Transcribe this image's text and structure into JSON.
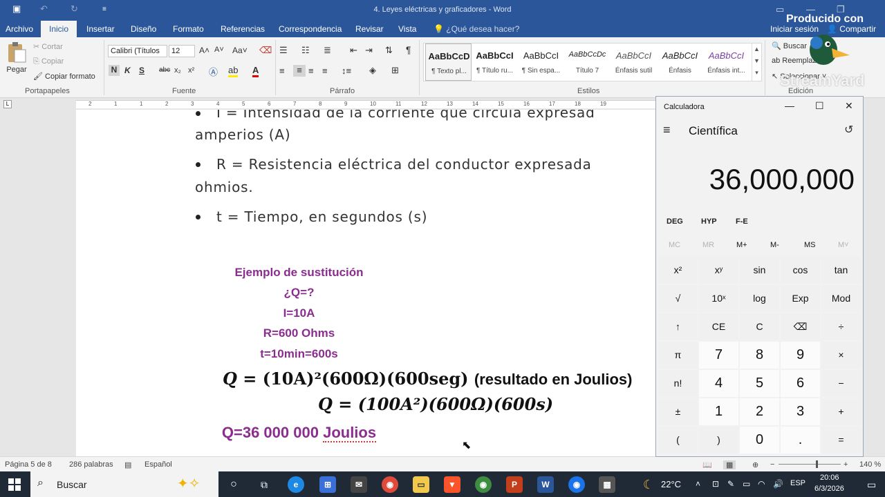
{
  "word": {
    "title": "4. Leyes eléctricas y graficadores - Word",
    "tabs": [
      "Archivo",
      "Inicio",
      "Insertar",
      "Diseño",
      "Formato",
      "Referencias",
      "Correspondencia",
      "Revisar",
      "Vista"
    ],
    "tell_me": "¿Qué desea hacer?",
    "signin": "Iniciar sesión",
    "share": "Compartir",
    "clipboard": {
      "paste": "Pegar",
      "cut": "Cortar",
      "copy": "Copiar",
      "format_painter": "Copiar formato",
      "label": "Portapapeles"
    },
    "font": {
      "name": "Calibri (Títulos",
      "size": "12",
      "label": "Fuente",
      "case": "Aa",
      "bold": "N",
      "italic": "K",
      "underline": "S",
      "strike": "abc",
      "sub": "x₂",
      "sup": "x²"
    },
    "paragraph": {
      "label": "Párrafo"
    },
    "styles": {
      "label": "Estilos",
      "items": [
        {
          "sample": "AaBbCcD",
          "name": "¶ Texto pl..."
        },
        {
          "sample": "AaBbCcI",
          "name": "¶ Título ru..."
        },
        {
          "sample": "AaBbCcI",
          "name": "¶ Sin espa..."
        },
        {
          "sample": "AaBbCcDc",
          "name": "Título 7"
        },
        {
          "sample": "AaBbCcI",
          "name": "Énfasis sutil"
        },
        {
          "sample": "AaBbCcI",
          "name": "Énfasis"
        },
        {
          "sample": "AaBbCcI",
          "name": "Énfasis int..."
        }
      ]
    },
    "editing": {
      "label": "Edición",
      "find": "Buscar",
      "replace": "Reemplazar",
      "select": "Seleccionar"
    },
    "watermark": {
      "produced_by": "Producido con",
      "brand": "StreamYard"
    },
    "ruler_numbers": [
      "2",
      "1",
      "1",
      "2",
      "3",
      "4",
      "5",
      "6",
      "7",
      "8",
      "9",
      "10",
      "11",
      "12",
      "13",
      "14",
      "15",
      "16",
      "17",
      "18",
      "19"
    ]
  },
  "document": {
    "bullet_partial": "I = Intensidad de la corriente que circula expresad",
    "bullet_i_cont": "amperios (A)",
    "bullet_r": "R = Resistencia eléctrica del conductor expresada",
    "bullet_r_cont": "ohmios.",
    "bullet_t": "t = Tiempo, en segundos (s)",
    "example_title": "Ejemplo de sustitución",
    "q": "¿Q=?",
    "i": "I=10A",
    "r": "R=600 Ohms",
    "t": "t=10min=600s",
    "eq1_lhs": "Q",
    "eq1_rhs": "=  (10A)²(600Ω)(600seg)",
    "eq1_note": "(resultado en Joulios)",
    "eq2": "Q = (100A²)(600Ω)(600s)",
    "result_main": "Q=36 000 000 ",
    "result_unit": "Joulios"
  },
  "status": {
    "page": "Página 5 de 8",
    "words": "286 palabras",
    "language": "Español",
    "zoom": "140 %",
    "zoom_fraction": 0.62
  },
  "taskbar": {
    "search": "Buscar",
    "weather": "22°C",
    "lang": "ESP",
    "time": "20:06",
    "date": "6/3/2026"
  },
  "calculator": {
    "title": "Calculadora",
    "mode": "Científica",
    "display": "36,000,000",
    "angle_row": [
      "DEG",
      "HYP",
      "F-E"
    ],
    "memory_row": [
      {
        "label": "MC",
        "enabled": false
      },
      {
        "label": "MR",
        "enabled": false
      },
      {
        "label": "M+",
        "enabled": true
      },
      {
        "label": "M-",
        "enabled": true
      },
      {
        "label": "MS",
        "enabled": true
      },
      {
        "label": "M˅",
        "enabled": false
      }
    ],
    "keys": [
      [
        "x²",
        "xʸ",
        "sin",
        "cos",
        "tan"
      ],
      [
        "√",
        "10ˣ",
        "log",
        "Exp",
        "Mod"
      ],
      [
        "↑",
        "CE",
        "C",
        "⌫",
        "÷"
      ],
      [
        "π",
        "7",
        "8",
        "9",
        "×"
      ],
      [
        "n!",
        "4",
        "5",
        "6",
        "−"
      ],
      [
        "±",
        "1",
        "2",
        "3",
        "+"
      ],
      [
        "(",
        ")",
        "0",
        ".",
        "="
      ]
    ]
  }
}
